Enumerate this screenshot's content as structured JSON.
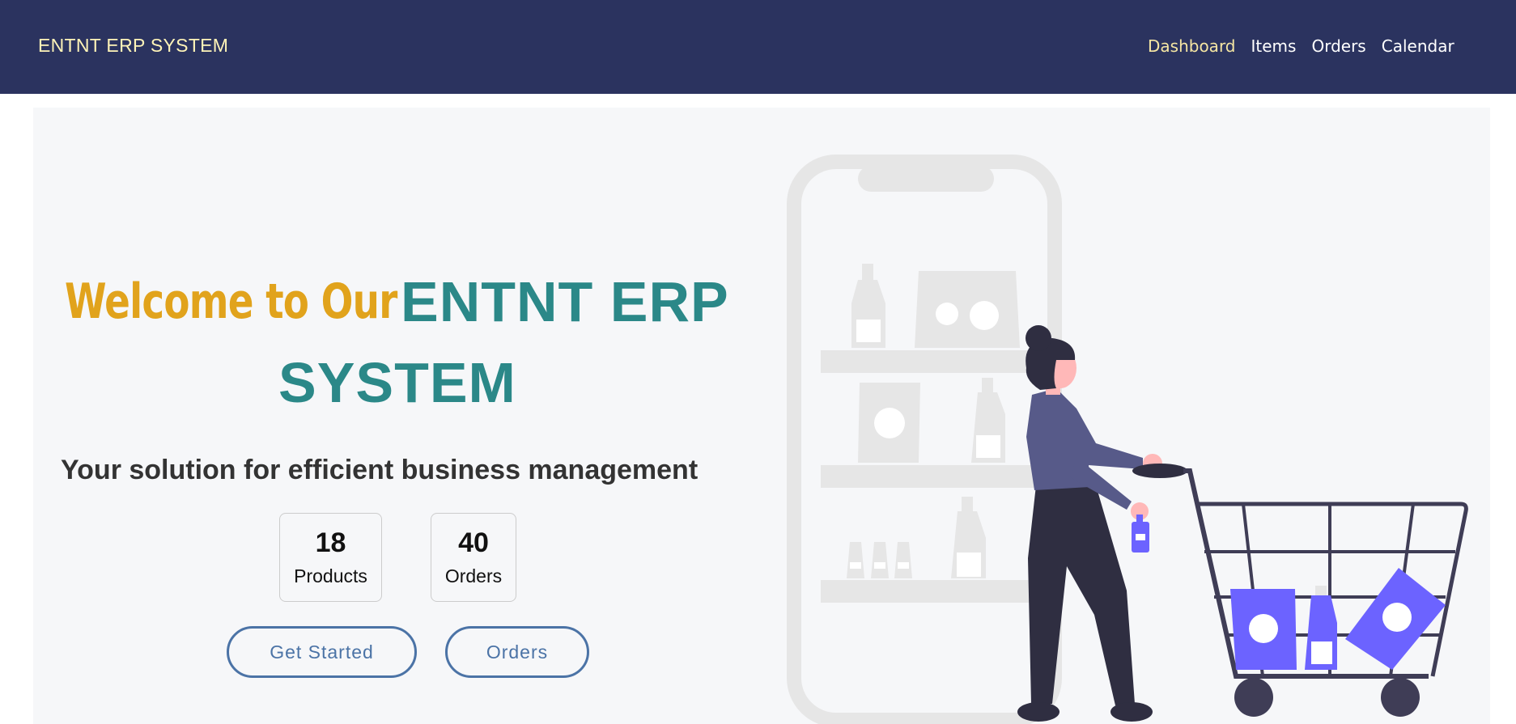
{
  "navbar": {
    "brand": "ENTNT ERP SYSTEM",
    "links": [
      "Dashboard",
      "Items",
      "Orders",
      "Calendar"
    ],
    "active_link": "Dashboard"
  },
  "hero": {
    "welcome_prefix": "Welcome to Our",
    "title_line1": "ENTNT ERP",
    "title_line2": "SYSTEM",
    "subtitle": "Your solution for efficient business management",
    "stats": [
      {
        "value": "18",
        "label": "Products"
      },
      {
        "value": "40",
        "label": "Orders"
      }
    ],
    "buttons": {
      "get_started": "Get Started",
      "orders": "Orders"
    }
  },
  "colors": {
    "navbar_bg": "#2b335f",
    "brand": "#fff4b8",
    "active_link": "#f5e6a3",
    "welcome_gold": "#e1a31c",
    "title_teal": "#2b8888",
    "button_blue": "#4b73a6",
    "accent_purple": "#6c63ff"
  },
  "illustration": {
    "name": "shopping-woman-cart-phone-illustration"
  }
}
